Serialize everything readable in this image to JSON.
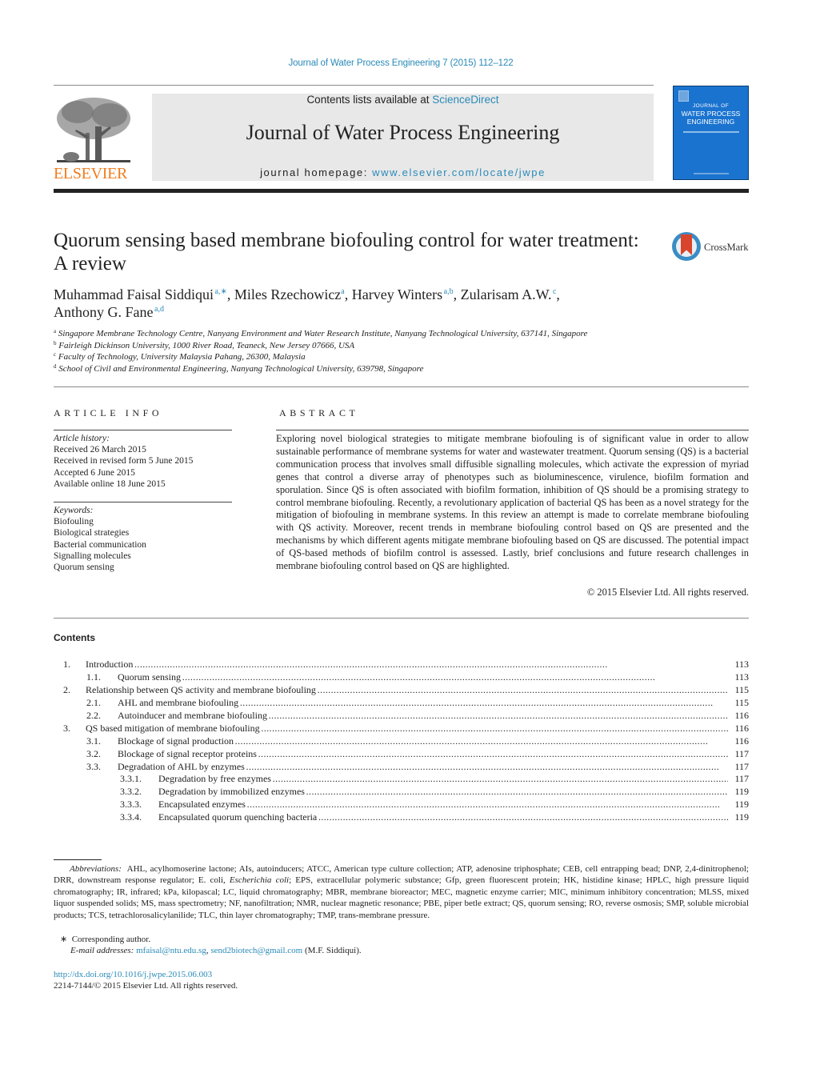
{
  "header": {
    "journal_reference": "Journal of Water Process Engineering 7 (2015) 112–122",
    "contents_prefix": "Contents lists available at ",
    "contents_link": "ScienceDirect",
    "journal_title": "Journal of Water Process Engineering",
    "homepage_prefix": "journal homepage: ",
    "homepage_link": "www.elsevier.com/locate/jwpe",
    "publisher_logo_text": "ELSEVIER",
    "cover": {
      "line1": "JOURNAL OF",
      "line2": "WATER PROCESS",
      "line3": "ENGINEERING",
      "background_color": "#1a73cf"
    }
  },
  "article": {
    "title": "Quorum sensing based membrane biofouling control for water treatment: A review",
    "crossmark_label": "CrossMark",
    "authors": [
      {
        "name": "Muhammad Faisal Siddiqui",
        "affil": "a,∗",
        "sep": ", "
      },
      {
        "name": "Miles Rzechowicz",
        "affil": "a",
        "sep": ", "
      },
      {
        "name": "Harvey Winters",
        "affil": "a,b",
        "sep": ", "
      },
      {
        "name": "Zularisam A.W.",
        "affil": "c",
        "sep": ","
      },
      {
        "name": "Anthony G. Fane",
        "affil": "a,d",
        "sep": ""
      }
    ],
    "affiliations": [
      {
        "mark": "a",
        "text": "Singapore Membrane Technology Centre, Nanyang Environment and Water Research Institute, Nanyang Technological University, 637141, Singapore"
      },
      {
        "mark": "b",
        "text": "Fairleigh Dickinson University, 1000 River Road, Teaneck, New Jersey 07666, USA"
      },
      {
        "mark": "c",
        "text": "Faculty of Technology, University Malaysia Pahang, 26300, Malaysia"
      },
      {
        "mark": "d",
        "text": "School of Civil and Environmental Engineering, Nanyang Technological University, 639798, Singapore"
      }
    ]
  },
  "article_info": {
    "heading": "ARTICLE INFO",
    "history_label": "Article history:",
    "history": [
      "Received 26 March 2015",
      "Received in revised form 5 June 2015",
      "Accepted 6 June 2015",
      "Available online 18 June 2015"
    ],
    "keywords_label": "Keywords:",
    "keywords": [
      "Biofouling",
      "Biological strategies",
      "Bacterial communication",
      "Signalling molecules",
      "Quorum sensing"
    ]
  },
  "abstract": {
    "heading": "ABSTRACT",
    "text": "Exploring novel biological strategies to mitigate membrane biofouling is of significant value in order to allow sustainable performance of membrane systems for water and wastewater treatment. Quorum sens­ing (QS) is a bacterial communication process that involves small diffusible signalling molecules, which activate the expression of myriad genes that control a diverse array of phenotypes such as biolumines­cence, virulence, biofilm formation and sporulation. Since QS is often associated with biofilm formation, inhibition of QS should be a promising strategy to control membrane biofouling. Recently, a revolution­ary application of bacterial QS has been as a novel strategy for the mitigation of biofouling in membrane systems. In this review an attempt is made to correlate membrane biofouling with QS activity. Moreover, recent trends in membrane biofouling control based on QS are presented and the mechanisms by which different agents mitigate membrane biofouling based on QS are discussed. The potential impact of QS-based methods of biofilm control is assessed. Lastly, brief conclusions and future research challenges in membrane biofouling control based on QS are highlighted.",
    "copyright": "© 2015 Elsevier Ltd. All rights reserved."
  },
  "contents": {
    "heading": "Contents",
    "entries": [
      {
        "level": 1,
        "num": "1.",
        "title": "Introduction",
        "page": "113"
      },
      {
        "level": 2,
        "num": "1.1.",
        "title": "Quorum sensing",
        "page": "113"
      },
      {
        "level": 1,
        "num": "2.",
        "title": "Relationship between QS activity and membrane biofouling",
        "page": "115"
      },
      {
        "level": 2,
        "num": "2.1.",
        "title": "AHL and membrane biofouling",
        "page": "115"
      },
      {
        "level": 2,
        "num": "2.2.",
        "title": "Autoinducer and membrane biofouling",
        "page": "116"
      },
      {
        "level": 1,
        "num": "3.",
        "title": "QS based mitigation of membrane biofouling",
        "page": "116"
      },
      {
        "level": 2,
        "num": "3.1.",
        "title": "Blockage of signal production",
        "page": "116"
      },
      {
        "level": 2,
        "num": "3.2.",
        "title": "Blockage of signal receptor proteins",
        "page": "117"
      },
      {
        "level": 2,
        "num": "3.3.",
        "title": "Degradation of AHL by enzymes",
        "page": "117"
      },
      {
        "level": 3,
        "num": "3.3.1.",
        "title": "Degradation by free enzymes",
        "page": "117"
      },
      {
        "level": 3,
        "num": "3.3.2.",
        "title": "Degradation by immobilized enzymes",
        "page": "119"
      },
      {
        "level": 3,
        "num": "3.3.3.",
        "title": "Encapsulated enzymes",
        "page": "119"
      },
      {
        "level": 3,
        "num": "3.3.4.",
        "title": "Encapsulated quorum quenching bacteria",
        "page": "119"
      }
    ]
  },
  "footnotes": {
    "abbreviations_label": "Abbreviations:",
    "abbreviations_part1": "AHL, acylhomoserine lactone; AIs, autoinducers; ATCC, American type culture collection; ATP, adenosine triphosphate; CEB, cell entrapping bead; DNP, 2,4-dinitrophenol; DRR, downstream response regulator; E. coli, ",
    "abbreviations_italic": "Escherichia coli",
    "abbreviations_part2": "; EPS, extracellular polymeric substance; Gfp, green fluorescent protein; HK, histidine kinase; HPLC, high pressure liquid chromatography; IR, infrared; kPa, kilopascal; LC, liquid chromatography; MBR, membrane bioreactor; MEC, magnetic enzyme carrier; MIC, minimum inhibitory concentration; MLSS, mixed liquor suspended solids; MS, mass spectrometry; NF, nanofiltration; NMR, nuclear magnetic resonance; PBE, piper betle extract; QS, quorum sensing; RO, reverse osmosis; SMP, soluble microbial products; TCS, tetrachlorosalicylanilide; TLC, thin layer chromatography; TMP, trans-membrane pressure.",
    "corresponding_mark": "∗",
    "corresponding_text": "Corresponding author.",
    "email_label": "E-mail addresses:",
    "email_1": "mfaisal@ntu.edu.sg",
    "email_sep": ", ",
    "email_2": "send2biotech@gmail.com",
    "email_suffix": " (M.F. Siddiqui).",
    "doi_link": "http://dx.doi.org/10.1016/j.jwpe.2015.06.003",
    "issn_line": "2214-7144/© 2015 Elsevier Ltd. All rights reserved."
  },
  "colors": {
    "link": "#2a8ab8",
    "elsevier_orange": "#f07d1f",
    "header_band": "#e8e8e8",
    "crossmark_red": "#d9442c",
    "crossmark_blue": "#3a8cc4"
  }
}
